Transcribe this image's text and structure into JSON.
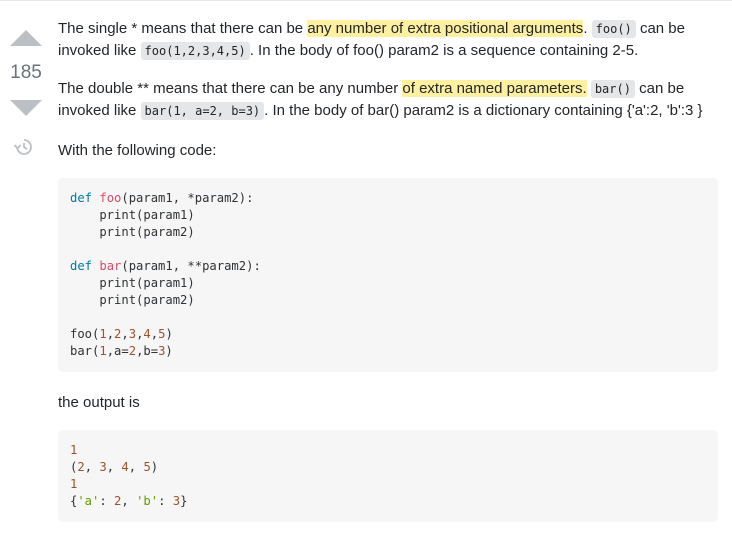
{
  "vote": {
    "score": "185"
  },
  "paragraphs": {
    "p1": {
      "t1": "The single * means that there can be ",
      "hl": "any number of extra positional arguments",
      "t2": ". ",
      "code1": "foo()",
      "t3": " can be invoked like ",
      "code2": "foo(1,2,3,4,5)",
      "t4": ". In the body of foo() param2 is a sequence containing 2-5."
    },
    "p2": {
      "t1": "The double ** means that there can be any number ",
      "hl": "of extra named parameters.",
      "t2": " ",
      "code1": "bar()",
      "t3": " can be invoked like ",
      "code2": "bar(1, a=2, b=3)",
      "t4": ". In the body of bar() param2 is a dictionary containing {'a':2, 'b':3 }"
    },
    "p3": "With the following code:",
    "p4": "the output is"
  },
  "code_block_1": {
    "line1": {
      "kw": "def",
      "fn": "foo",
      "rest": "(param1, *param2):"
    },
    "line2": "    print(param1)",
    "line3": "    print(param2)",
    "line5": {
      "kw": "def",
      "fn": "bar",
      "rest": "(param1, **param2):"
    },
    "line6": "    print(param1)",
    "line7": "    print(param2)",
    "line9": {
      "name": "foo",
      "open": "(",
      "args": [
        "1",
        "2",
        "3",
        "4",
        "5"
      ],
      "close": ")"
    },
    "line10": {
      "name": "bar",
      "p1": "(",
      "n1": "1",
      "p2": ",a=",
      "n2": "2",
      "p3": ",b=",
      "n3": "3",
      "p4": ")"
    }
  },
  "code_block_2": {
    "line1": "1",
    "line2": {
      "open": "(",
      "nums": [
        "2",
        "3",
        "4",
        "5"
      ],
      "close": ")"
    },
    "line3": "1",
    "line4": {
      "open": "{",
      "k1": "'a'",
      "colon1": ": ",
      "v1": "2",
      "sep": ", ",
      "k2": "'b'",
      "colon2": ": ",
      "v2": "3",
      "close": "}"
    }
  }
}
